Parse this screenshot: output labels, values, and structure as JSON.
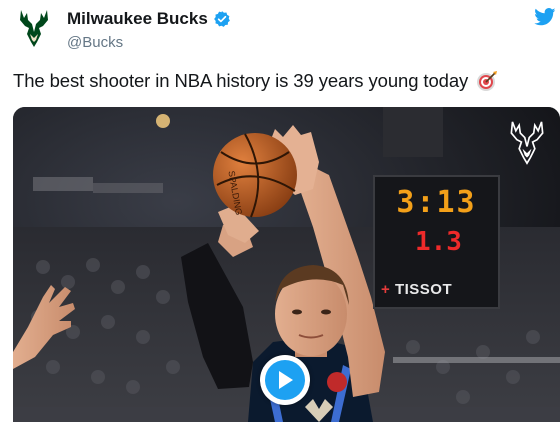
{
  "tweet": {
    "display_name": "Milwaukee Bucks",
    "handle": "@Bucks",
    "verified": true,
    "text": "The best shooter in NBA history is 39 years young today",
    "emoji": "target-emoji"
  },
  "media": {
    "type": "video",
    "scoreboard": {
      "shot_clock": "3:13",
      "game_clock": "1.3",
      "sponsor": "TISSOT"
    },
    "ball_text": "SPALDING"
  },
  "colors": {
    "twitter_blue": "#1da1f2",
    "bucks_green": "#00471b",
    "shot_clock": "#f3a019",
    "game_clock": "#ee2a2a"
  },
  "icons": [
    "bucks-logo-icon",
    "verified-badge-icon",
    "twitter-bird-icon",
    "play-icon",
    "bucks-watermark-icon"
  ]
}
